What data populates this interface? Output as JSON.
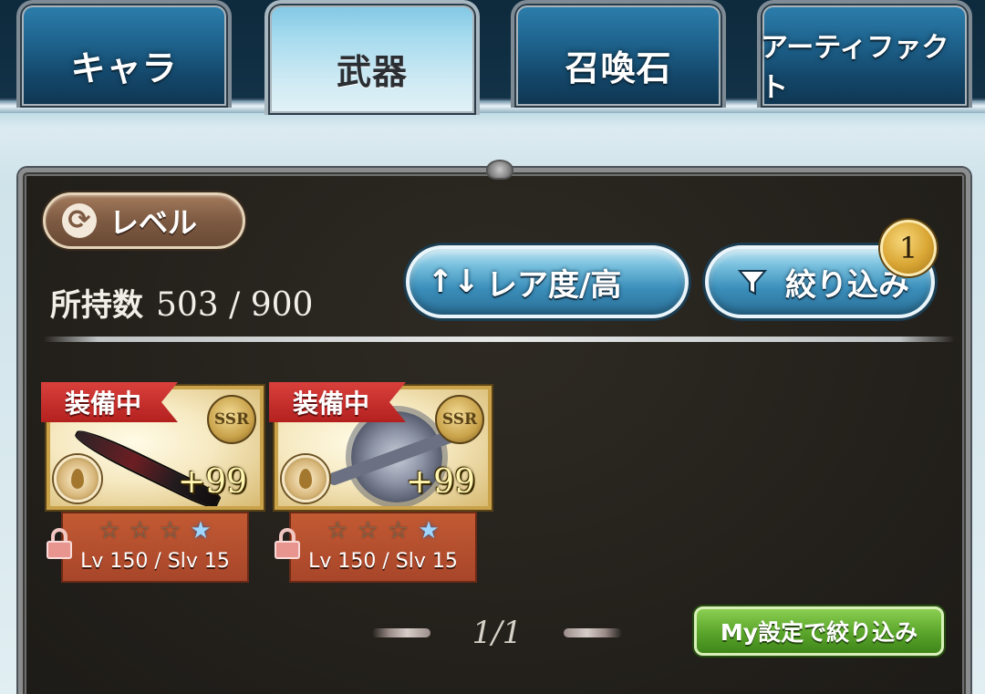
{
  "tabs": [
    {
      "label": "キャラ",
      "active": false
    },
    {
      "label": "武器",
      "active": true
    },
    {
      "label": "召喚石",
      "active": false
    },
    {
      "label": "アーティファクト",
      "active": false
    }
  ],
  "toolbar": {
    "sort_type_label": "レベル",
    "sort_type_icon": "refresh-icon",
    "owned_label": "所持数",
    "owned_count": "503 / 900",
    "rarity_sort_label": "レア度/高",
    "rarity_sort_icon": "↑↓",
    "filter_label": "絞り込み",
    "filter_icon": "funnel-icon",
    "filter_badge": "1"
  },
  "weapons": [
    {
      "status": "装備中",
      "rarity": "SSR",
      "plus": "+99",
      "stars": [
        "☆",
        "☆",
        "☆",
        "★"
      ],
      "level_text": "Lv 150 / Slv 15",
      "locked": true
    },
    {
      "status": "装備中",
      "rarity": "SSR",
      "plus": "+99",
      "stars": [
        "☆",
        "☆",
        "☆",
        "★"
      ],
      "level_text": "Lv 150 / Slv 15",
      "locked": true
    }
  ],
  "pagination": {
    "label": "1/1"
  },
  "my_filter_button": "My設定で絞り込み",
  "colors": {
    "tab_active": "#cfeaf4",
    "tab_inactive": "#1f6590",
    "panel_bg": "#24211c",
    "blue_button": "#3b8fbb",
    "equipped_ribbon": "#b3211f",
    "card_info": "#a8462a",
    "green_button": "#5da82d",
    "badge_gold": "#d9a634"
  }
}
